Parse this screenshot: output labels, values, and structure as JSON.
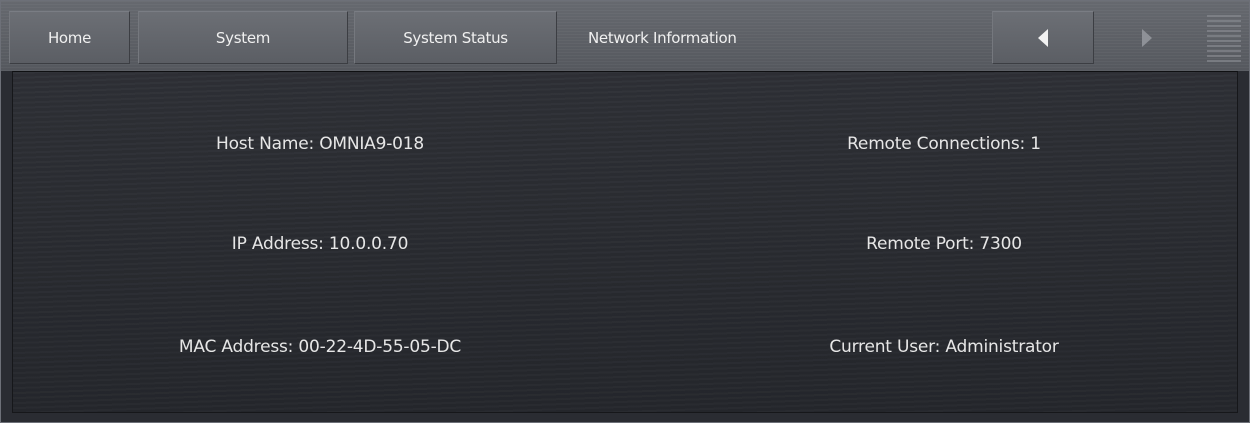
{
  "nav": {
    "tabs": [
      {
        "label": "Home"
      },
      {
        "label": "System"
      },
      {
        "label": "System Status"
      }
    ],
    "active_page": "Network Information",
    "prev_icon": "triangle-left-icon",
    "next_icon": "triangle-right-icon",
    "menu_icon": "hamburger-lines-icon"
  },
  "network_info": {
    "host_name": {
      "label": "Host Name:",
      "value": "OMNIA9-018"
    },
    "ip_address": {
      "label": "IP Address:",
      "value": "10.0.0.70"
    },
    "mac_address": {
      "label": "MAC Address:",
      "value": "00-22-4D-55-05-DC"
    },
    "remote_connections": {
      "label": "Remote Connections:",
      "value": "1"
    },
    "remote_port": {
      "label": "Remote Port:",
      "value": "7300"
    },
    "current_user": {
      "label": "Current User:",
      "value": "Administrator"
    }
  },
  "colors": {
    "topbar": "#5e6167",
    "panel": "#2a2c32",
    "text": "#e6e6e6",
    "arrow_active": "#f2f2f2",
    "arrow_inactive": "#8e9197"
  }
}
